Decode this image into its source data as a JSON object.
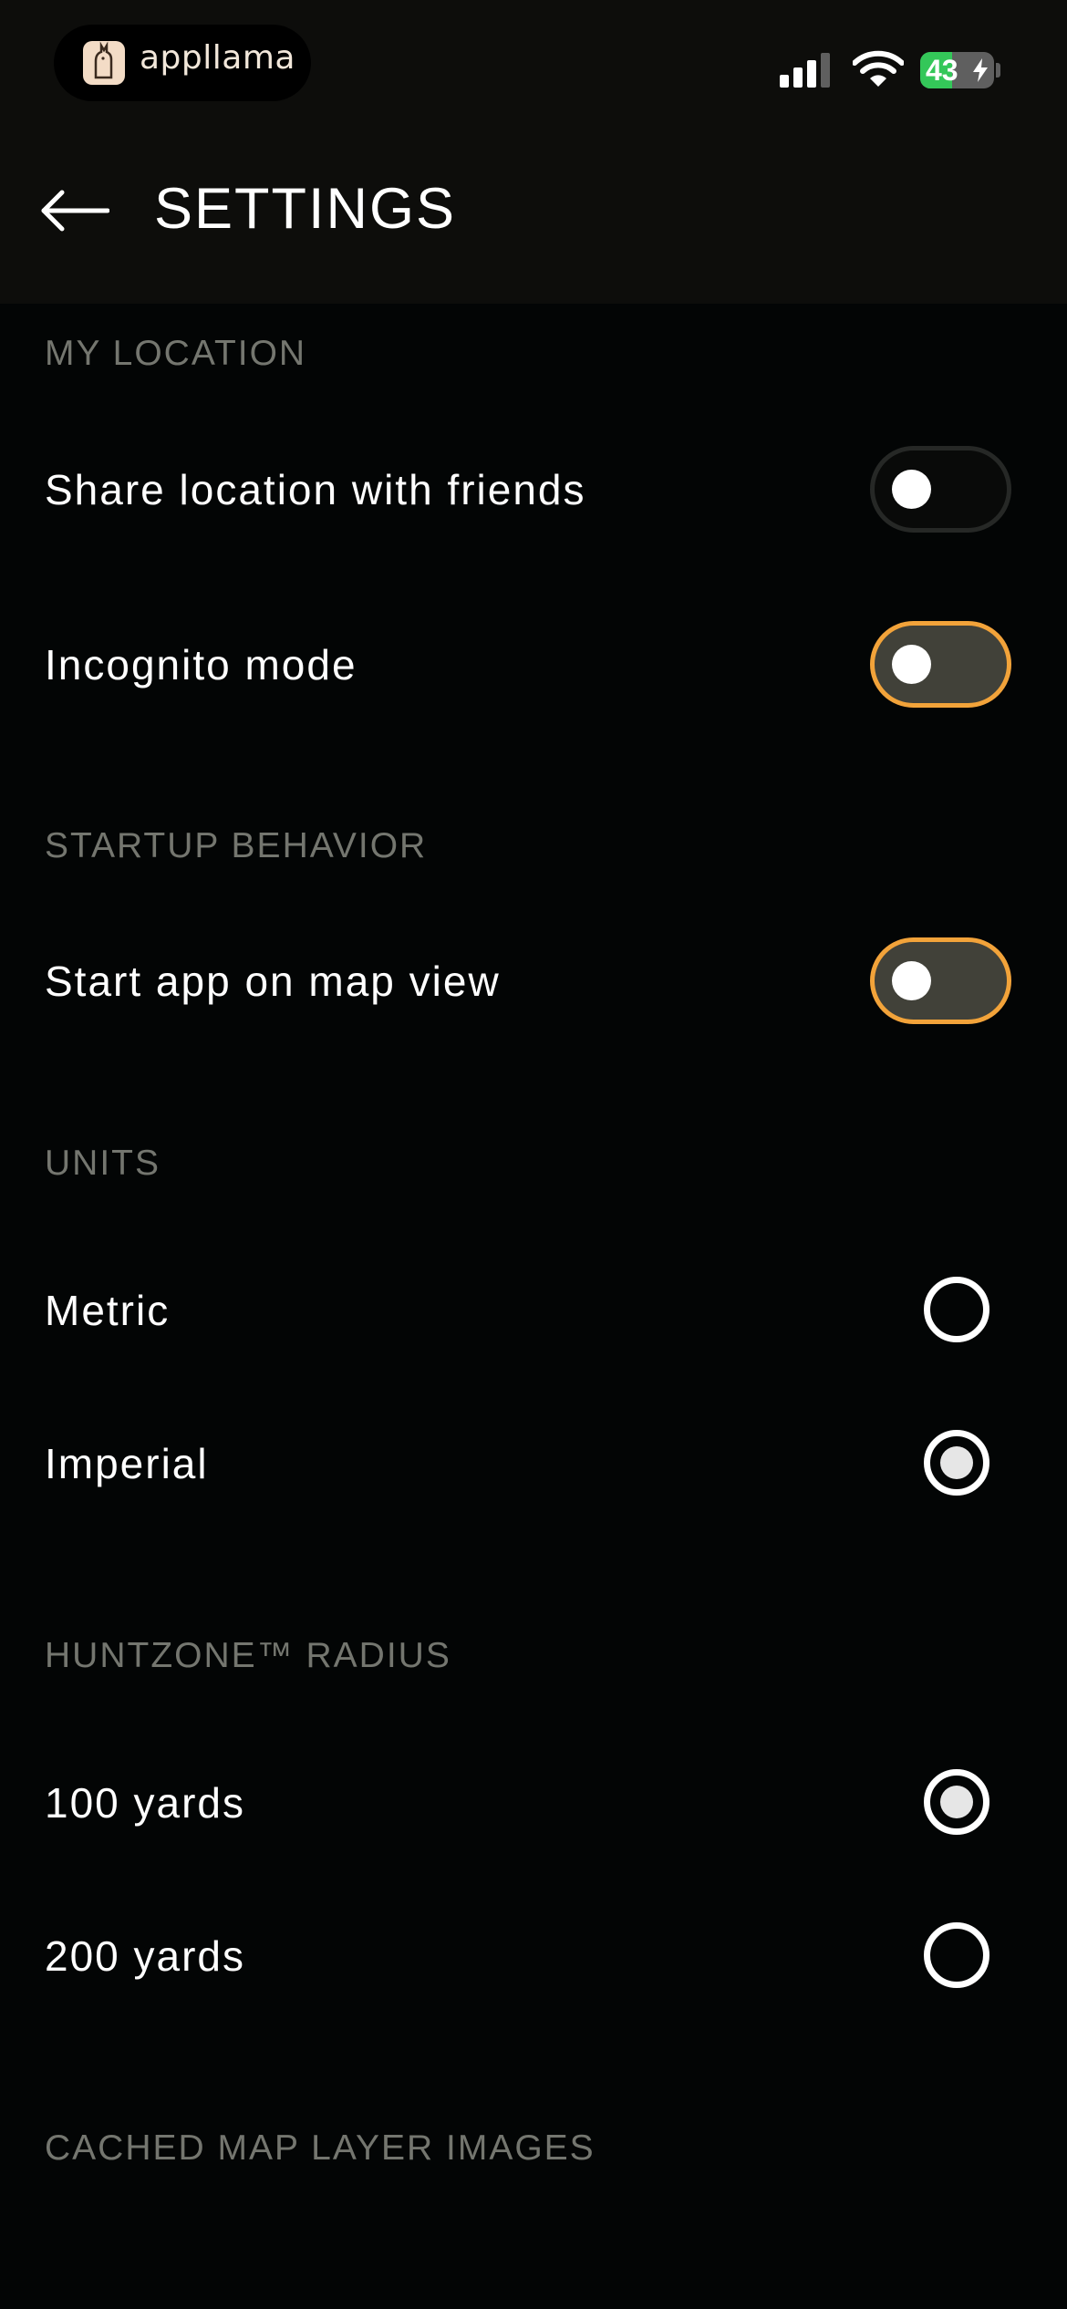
{
  "status_bar": {
    "app_pill_text": "appllama",
    "battery_level": "43",
    "battery_fraction": 0.43
  },
  "header": {
    "title": "SETTINGS"
  },
  "sections": {
    "my_location": {
      "label": "MY LOCATION",
      "share_location": {
        "label": "Share location with friends",
        "on": false
      },
      "incognito": {
        "label": "Incognito mode",
        "on": false
      }
    },
    "startup": {
      "label": "STARTUP BEHAVIOR",
      "start_on_map": {
        "label": "Start app on map view",
        "on": false
      }
    },
    "units": {
      "label": "UNITS",
      "metric": {
        "label": "Metric",
        "selected": false
      },
      "imperial": {
        "label": "Imperial",
        "selected": true
      }
    },
    "radius": {
      "label": "HUNTZONE™ RADIUS",
      "yards_100": {
        "label": "100 yards",
        "selected": true
      },
      "yards_200": {
        "label": "200 yards",
        "selected": false
      }
    },
    "cache": {
      "label": "CACHED MAP LAYER IMAGES"
    }
  },
  "colors": {
    "accent": "#f2a33a",
    "background": "#030505",
    "header_bg": "#0d0d0b",
    "section_label": "#74766f",
    "battery_green": "#34c759"
  },
  "icons": [
    "llama-logo-icon",
    "cellular-signal-icon",
    "wifi-icon",
    "battery-charging-icon",
    "back-arrow-icon"
  ]
}
